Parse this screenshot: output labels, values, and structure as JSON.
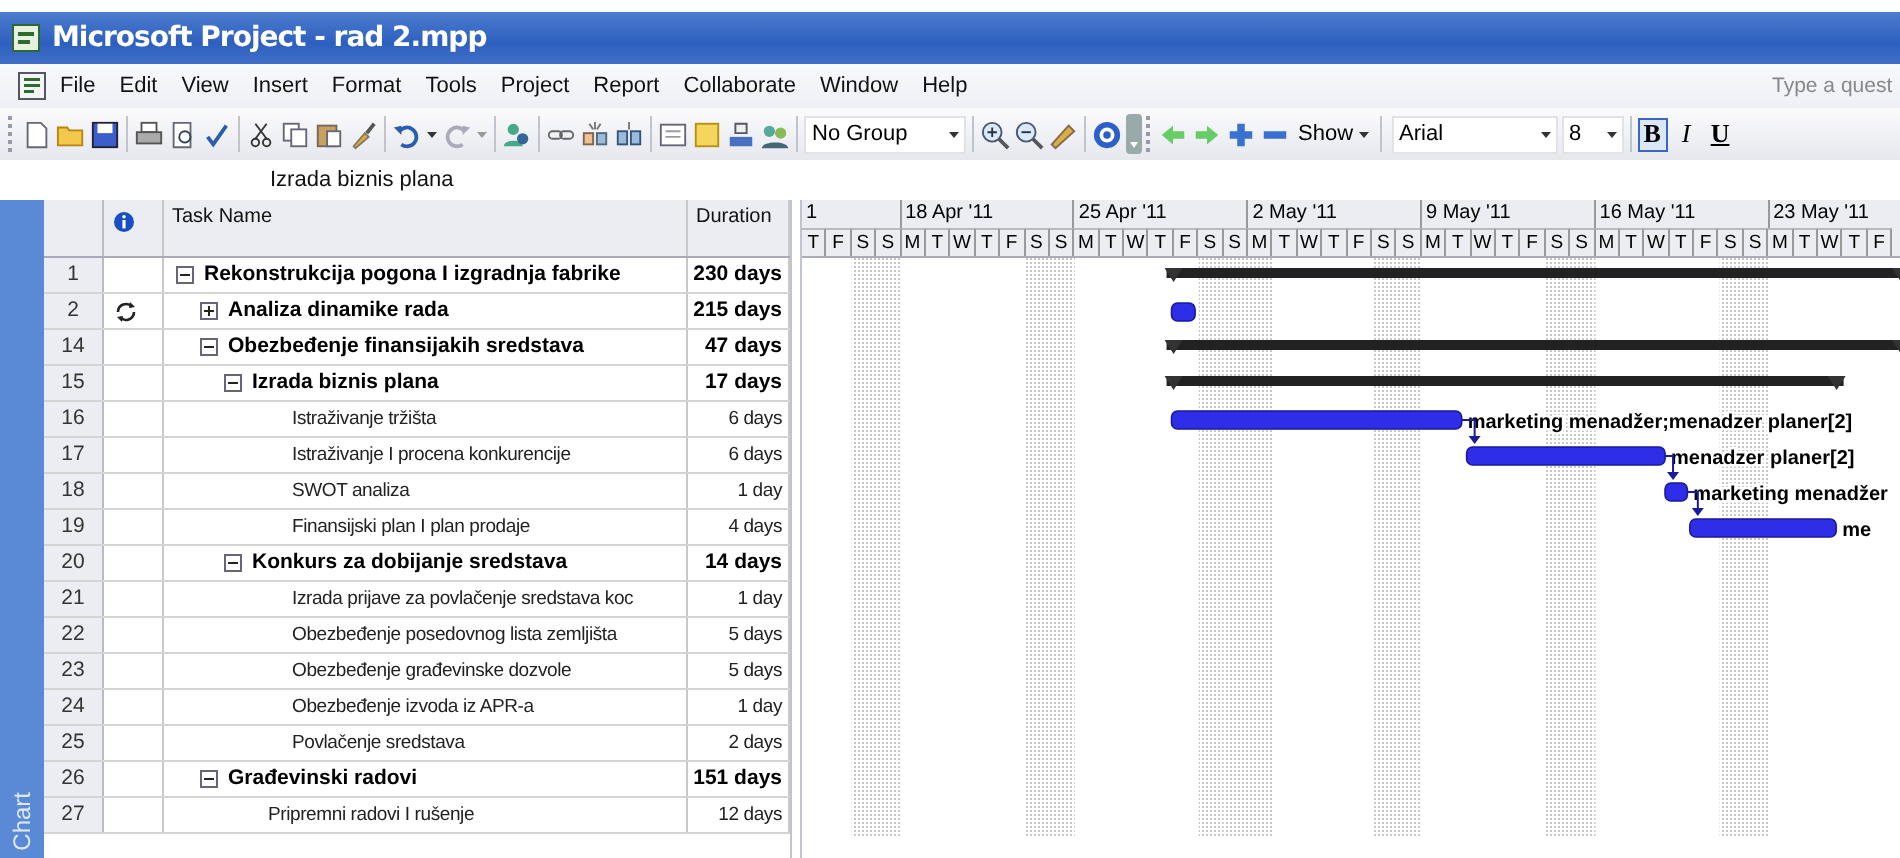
{
  "window": {
    "title": "Microsoft Project - rad 2.mpp"
  },
  "menu": [
    {
      "label": "File"
    },
    {
      "label": "Edit"
    },
    {
      "label": "View"
    },
    {
      "label": "Insert"
    },
    {
      "label": "Format"
    },
    {
      "label": "Tools"
    },
    {
      "label": "Project"
    },
    {
      "label": "Report"
    },
    {
      "label": "Collaborate"
    },
    {
      "label": "Window"
    },
    {
      "label": "Help"
    }
  ],
  "help_search": {
    "placeholder": "Type a quest"
  },
  "toolbar": {
    "group": "No Group",
    "show": "Show",
    "font": "Arial",
    "size": "8",
    "format_buttons": [
      {
        "label": "B",
        "on": true
      },
      {
        "label": "I",
        "on": false
      },
      {
        "label": "U",
        "on": false
      }
    ]
  },
  "entry_bar": {
    "value": "Izrada biznis plana"
  },
  "view_bar": {
    "label": "Chart"
  },
  "table": {
    "columns": [
      "Task Name",
      "Duration"
    ],
    "rows": [
      {
        "id": "1",
        "recurring": false,
        "name": "Rekonstrukcija pogona I izgradnja fabrike",
        "duration": "230 days",
        "summary": true,
        "expanded": true,
        "bar": {
          "kind": "summary"
        },
        "children": [
          {
            "id": "2",
            "recurring": true,
            "name": "Analiza dinamike rada",
            "duration": "215 days",
            "summary": true,
            "expanded": false,
            "bar": {
              "kind": "rollup"
            }
          },
          {
            "id": "14",
            "recurring": false,
            "name": "Obezbeđenje finansijakih sredstava",
            "duration": "47 days",
            "summary": true,
            "expanded": true,
            "bar": {
              "kind": "summary"
            },
            "children": [
              {
                "id": "15",
                "recurring": false,
                "name": "Izrada biznis plana",
                "duration": "17 days",
                "summary": true,
                "expanded": true,
                "bar": {
                  "kind": "summary"
                },
                "children": [
                  {
                    "id": "16",
                    "recurring": false,
                    "name": "Istraživanje tržišta",
                    "duration": "6 days",
                    "summary": false,
                    "linked": true,
                    "bar": {
                      "kind": "task",
                      "label": "marketing menadžer;menadzer planer[2]"
                    }
                  },
                  {
                    "id": "17",
                    "recurring": false,
                    "name": "Istraživanje I procena konkurencije",
                    "duration": "6 days",
                    "summary": false,
                    "linked": true,
                    "bar": {
                      "kind": "task",
                      "label": "menadzer planer[2]"
                    }
                  },
                  {
                    "id": "18",
                    "recurring": false,
                    "name": "SWOT analiza",
                    "duration": "1 day",
                    "summary": false,
                    "linked": true,
                    "bar": {
                      "kind": "task",
                      "label": "marketing menadžer"
                    }
                  },
                  {
                    "id": "19",
                    "recurring": false,
                    "name": "Finansijski plan I plan prodaje",
                    "duration": "4 days",
                    "summary": false,
                    "linked": false,
                    "bar": {
                      "kind": "task",
                      "label": "me"
                    }
                  }
                ]
              },
              {
                "id": "20",
                "recurring": false,
                "name": "Konkurs za dobijanje sredstava",
                "duration": "14 days",
                "summary": true,
                "expanded": true,
                "children": [
                  {
                    "id": "21",
                    "recurring": false,
                    "name": "Izrada prijave za povlačenje sredstava koc",
                    "duration": "1 day",
                    "summary": false
                  },
                  {
                    "id": "22",
                    "recurring": false,
                    "name": "Obezbeđenje posedovnog lista zemljišta",
                    "duration": "5 days",
                    "summary": false
                  },
                  {
                    "id": "23",
                    "recurring": false,
                    "name": "Obezbeđenje građevinske dozvole",
                    "duration": "5 days",
                    "summary": false
                  },
                  {
                    "id": "24",
                    "recurring": false,
                    "name": "Obezbeđenje izvoda iz APR-a",
                    "duration": "1 day",
                    "summary": false
                  },
                  {
                    "id": "25",
                    "recurring": false,
                    "name": "Povlačenje sredstava",
                    "duration": "2 days",
                    "summary": false
                  }
                ]
              }
            ]
          },
          {
            "id": "26",
            "recurring": false,
            "name": "Građevinski radovi",
            "duration": "151 days",
            "summary": true,
            "expanded": true,
            "children": [
              {
                "id": "27",
                "recurring": false,
                "name": "Pripremni radovi I rušenje",
                "duration": "12 days",
                "summary": false
              }
            ]
          }
        ]
      }
    ]
  },
  "gantt": {
    "days": [
      {
        "label": "T",
        "nonworking": false
      },
      {
        "label": "F",
        "nonworking": false
      },
      {
        "label": "S",
        "nonworking": true
      },
      {
        "label": "S",
        "nonworking": true
      },
      {
        "label": "M",
        "nonworking": false
      },
      {
        "label": "T",
        "nonworking": false
      },
      {
        "label": "W",
        "nonworking": false
      },
      {
        "label": "T",
        "nonworking": false
      },
      {
        "label": "F",
        "nonworking": false
      },
      {
        "label": "S",
        "nonworking": true
      },
      {
        "label": "S",
        "nonworking": true
      },
      {
        "label": "M",
        "nonworking": false
      },
      {
        "label": "T",
        "nonworking": false
      },
      {
        "label": "W",
        "nonworking": false
      },
      {
        "label": "T",
        "nonworking": false
      },
      {
        "label": "F",
        "nonworking": false
      },
      {
        "label": "S",
        "nonworking": true
      },
      {
        "label": "S",
        "nonworking": true
      },
      {
        "label": "M",
        "nonworking": true
      },
      {
        "label": "T",
        "nonworking": false
      },
      {
        "label": "W",
        "nonworking": false
      },
      {
        "label": "T",
        "nonworking": false
      },
      {
        "label": "F",
        "nonworking": false
      },
      {
        "label": "S",
        "nonworking": true
      },
      {
        "label": "S",
        "nonworking": true
      },
      {
        "label": "M",
        "nonworking": false
      },
      {
        "label": "T",
        "nonworking": false
      },
      {
        "label": "W",
        "nonworking": false
      },
      {
        "label": "T",
        "nonworking": false
      },
      {
        "label": "F",
        "nonworking": false
      },
      {
        "label": "S",
        "nonworking": true
      },
      {
        "label": "S",
        "nonworking": true
      },
      {
        "label": "M",
        "nonworking": false
      },
      {
        "label": "T",
        "nonworking": false
      },
      {
        "label": "W",
        "nonworking": false
      },
      {
        "label": "T",
        "nonworking": false
      },
      {
        "label": "F",
        "nonworking": false
      },
      {
        "label": "S",
        "nonworking": true
      },
      {
        "label": "S",
        "nonworking": true
      },
      {
        "label": "M",
        "nonworking": false
      },
      {
        "label": "T",
        "nonworking": false
      },
      {
        "label": "W",
        "nonworking": false
      },
      {
        "label": "T",
        "nonworking": false
      },
      {
        "label": "F",
        "nonworking": false
      }
    ],
    "weeks": [
      {
        "label": "1"
      },
      {
        "label": "18 Apr '11"
      },
      {
        "label": "25 Apr '11"
      },
      {
        "label": "2 May '11"
      },
      {
        "label": "9 May '11"
      },
      {
        "label": "16 May '11"
      },
      {
        "label": "23 May '11"
      }
    ]
  }
}
